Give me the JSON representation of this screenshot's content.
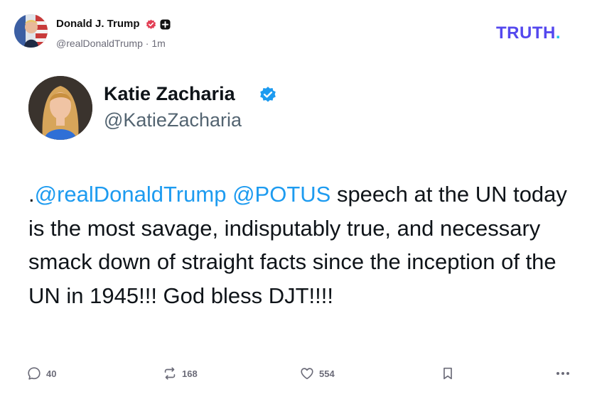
{
  "post": {
    "author_name": "Donald J. Trump",
    "author_handle": "@realDonaldTrump",
    "time_separator": " · ",
    "time": "1m",
    "brand": {
      "text": "TRUTH",
      "dot": ".",
      "color": "#5448ee",
      "dot_color": "#21c7e9"
    }
  },
  "quoted": {
    "name": "Katie Zacharia",
    "handle": "@KatieZacharia",
    "body": {
      "lead": ".",
      "mention1": "@realDonaldTrump",
      "space1": " ",
      "mention2": "@POTUS",
      "rest": " speech at the UN today is the most savage, indisputably true, and necessary smack down of straight facts since the inception of the UN in 1945!!! God bless DJT!!!!"
    },
    "mention_color": "#1d9bf0"
  },
  "actions": {
    "replies": "40",
    "reposts": "168",
    "likes": "554"
  },
  "icons": {
    "verified_top": "verified-badge-red-icon",
    "plus": "plus-badge-icon",
    "verified_card": "verified-check-icon",
    "reply": "reply-icon",
    "repost": "repost-icon",
    "like": "heart-icon",
    "save": "bookmark-icon",
    "more": "more-icon"
  }
}
